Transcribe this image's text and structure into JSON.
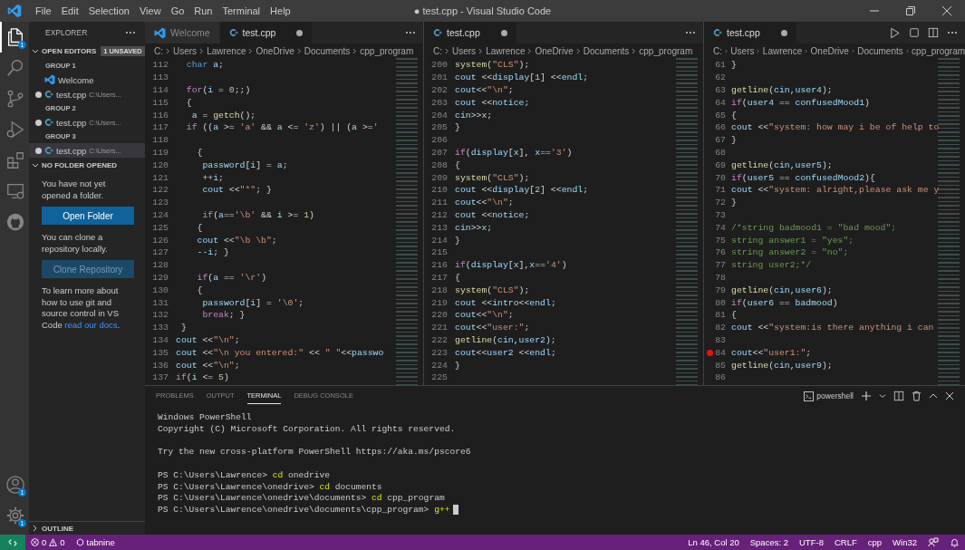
{
  "window": {
    "title": "● test.cpp - Visual Studio Code",
    "menu": [
      "File",
      "Edit",
      "Selection",
      "View",
      "Go",
      "Run",
      "Terminal",
      "Help"
    ]
  },
  "activity_bar": {
    "top": [
      {
        "kind": "explorer",
        "selected": true,
        "badge": "1"
      },
      {
        "kind": "search",
        "selected": false
      },
      {
        "kind": "source-control",
        "selected": false
      },
      {
        "kind": "run-debug",
        "selected": false
      },
      {
        "kind": "extensions",
        "selected": false
      },
      {
        "kind": "remote",
        "selected": false
      },
      {
        "kind": "github",
        "selected": false
      }
    ],
    "bottom": [
      {
        "kind": "account",
        "badge": "1"
      },
      {
        "kind": "settings",
        "badge": "1"
      }
    ]
  },
  "sidebar": {
    "title": "EXPLORER",
    "open_editors": {
      "label": "OPEN EDITORS",
      "badge": "1 UNSAVED",
      "expanded": true,
      "groups": [
        {
          "label": "GROUP 1",
          "items": [
            {
              "kind": "vscode",
              "label": "Welcome",
              "dirty": false,
              "selected": false
            },
            {
              "kind": "cpp",
              "label": "test.cpp",
              "path": "C:\\Users...",
              "dirty": true,
              "selected": false
            }
          ]
        },
        {
          "label": "GROUP 2",
          "items": [
            {
              "kind": "cpp",
              "label": "test.cpp",
              "path": "C:\\Users...",
              "dirty": true,
              "selected": false
            }
          ]
        },
        {
          "label": "GROUP 3",
          "items": [
            {
              "kind": "cpp",
              "label": "test.cpp",
              "path": "C:\\Users...",
              "dirty": true,
              "selected": true
            }
          ]
        }
      ]
    },
    "no_folder": {
      "label": "NO FOLDER OPENED",
      "expanded": true,
      "text1": "You have not yet opened a folder.",
      "open_button": "Open Folder",
      "text2": "You can clone a repository locally.",
      "clone_button": "Clone Repository",
      "text3": "To learn more about how to use git and source control in VS Code",
      "link": "read our docs",
      "text3_end": "."
    },
    "outline": {
      "label": "OUTLINE",
      "expanded": false
    }
  },
  "editors": [
    {
      "tabs": [
        {
          "kind": "vscode",
          "label": "Welcome",
          "selected": false,
          "dirty": false
        },
        {
          "kind": "cpp",
          "label": "test.cpp",
          "selected": true,
          "dirty": true
        }
      ],
      "actions": [
        {
          "kind": "more"
        }
      ],
      "breadcrumbs": [
        "C:",
        "Users",
        "Lawrence",
        "OneDrive",
        "Documents",
        "cpp_program"
      ],
      "lines": [
        {
          "n": "112",
          "parts": [
            {
              "kind": "type",
              "text": "  char"
            },
            {
              "kind": "var",
              "text": " a"
            },
            {
              "kind": "p",
              "text": ";"
            }
          ]
        },
        {
          "n": "113"
        },
        {
          "n": "114",
          "parts": [
            {
              "kind": "kw",
              "text": "  for"
            },
            {
              "kind": "p",
              "text": "("
            },
            {
              "kind": "var",
              "text": "i"
            },
            {
              "kind": "p",
              "text": " = "
            },
            {
              "kind": "num",
              "text": "0"
            },
            {
              "kind": "p",
              "text": ";;)"
            }
          ]
        },
        {
          "n": "115",
          "parts": [
            {
              "kind": "p",
              "text": "  {"
            }
          ]
        },
        {
          "n": "116",
          "parts": [
            {
              "kind": "var",
              "text": "   a"
            },
            {
              "kind": "p",
              "text": " = "
            },
            {
              "kind": "fn",
              "text": "getch"
            },
            {
              "kind": "p",
              "text": "();"
            }
          ]
        },
        {
          "n": "117",
          "parts": [
            {
              "kind": "kw",
              "text": "  if"
            },
            {
              "kind": "p",
              "text": " (("
            },
            {
              "kind": "var",
              "text": "a"
            },
            {
              "kind": "p",
              "text": " >= "
            },
            {
              "kind": "str",
              "text": "'a'"
            },
            {
              "kind": "p",
              "text": " && "
            },
            {
              "kind": "var",
              "text": "a"
            },
            {
              "kind": "p",
              "text": " <= "
            },
            {
              "kind": "str",
              "text": "'z'"
            },
            {
              "kind": "p",
              "text": ") || ("
            },
            {
              "kind": "var",
              "text": "a"
            },
            {
              "kind": "p",
              "text": " >="
            },
            {
              "kind": "str",
              "text": "'"
            }
          ]
        },
        {
          "n": "118"
        },
        {
          "n": "119",
          "parts": [
            {
              "kind": "p",
              "text": "    {"
            }
          ]
        },
        {
          "n": "120",
          "parts": [
            {
              "kind": "var",
              "text": "     password"
            },
            {
              "kind": "p",
              "text": "["
            },
            {
              "kind": "var",
              "text": "i"
            },
            {
              "kind": "p",
              "text": "] = "
            },
            {
              "kind": "var",
              "text": "a"
            },
            {
              "kind": "p",
              "text": ";"
            }
          ]
        },
        {
          "n": "121",
          "parts": [
            {
              "kind": "p",
              "text": "     ++"
            },
            {
              "kind": "var",
              "text": "i"
            },
            {
              "kind": "p",
              "text": ";"
            }
          ]
        },
        {
          "n": "122",
          "parts": [
            {
              "kind": "var",
              "text": "     cout"
            },
            {
              "kind": "p",
              "text": " <<"
            },
            {
              "kind": "str",
              "text": "\"*\""
            },
            {
              "kind": "p",
              "text": "; }"
            }
          ]
        },
        {
          "n": "123"
        },
        {
          "n": "124",
          "parts": [
            {
              "kind": "kw",
              "text": "     if"
            },
            {
              "kind": "p",
              "text": "("
            },
            {
              "kind": "var",
              "text": "a"
            },
            {
              "kind": "p",
              "text": "=="
            },
            {
              "kind": "str",
              "text": "'\\b'"
            },
            {
              "kind": "p",
              "text": " && "
            },
            {
              "kind": "var",
              "text": "i"
            },
            {
              "kind": "p",
              "text": " >= "
            },
            {
              "kind": "num",
              "text": "1"
            },
            {
              "kind": "p",
              "text": ")"
            }
          ]
        },
        {
          "n": "125",
          "parts": [
            {
              "kind": "p",
              "text": "    {"
            }
          ]
        },
        {
          "n": "126",
          "parts": [
            {
              "kind": "var",
              "text": "    cout"
            },
            {
              "kind": "p",
              "text": " <<"
            },
            {
              "kind": "str",
              "text": "\"\\b \\b\""
            },
            {
              "kind": "p",
              "text": ";"
            }
          ]
        },
        {
          "n": "127",
          "parts": [
            {
              "kind": "p",
              "text": "    --"
            },
            {
              "kind": "var",
              "text": "i"
            },
            {
              "kind": "p",
              "text": "; }"
            }
          ]
        },
        {
          "n": "128"
        },
        {
          "n": "129",
          "parts": [
            {
              "kind": "kw",
              "text": "    if"
            },
            {
              "kind": "p",
              "text": "("
            },
            {
              "kind": "var",
              "text": "a"
            },
            {
              "kind": "p",
              "text": " == "
            },
            {
              "kind": "str",
              "text": "'\\r'"
            },
            {
              "kind": "p",
              "text": ")"
            }
          ]
        },
        {
          "n": "130",
          "parts": [
            {
              "kind": "p",
              "text": "    {"
            }
          ]
        },
        {
          "n": "131",
          "parts": [
            {
              "kind": "var",
              "text": "     password"
            },
            {
              "kind": "p",
              "text": "["
            },
            {
              "kind": "var",
              "text": "i"
            },
            {
              "kind": "p",
              "text": "] = "
            },
            {
              "kind": "str",
              "text": "'\\0'"
            },
            {
              "kind": "p",
              "text": ";"
            }
          ]
        },
        {
          "n": "132",
          "parts": [
            {
              "kind": "kw",
              "text": "     break"
            },
            {
              "kind": "p",
              "text": "; }"
            }
          ]
        },
        {
          "n": "133",
          "parts": [
            {
              "kind": "p",
              "text": " }"
            }
          ]
        },
        {
          "n": "134",
          "parts": [
            {
              "kind": "var",
              "text": "cout"
            },
            {
              "kind": "p",
              "text": " <<"
            },
            {
              "kind": "str",
              "text": "\"\\n\""
            },
            {
              "kind": "p",
              "text": ";"
            }
          ]
        },
        {
          "n": "135",
          "parts": [
            {
              "kind": "var",
              "text": "cout"
            },
            {
              "kind": "p",
              "text": " <<"
            },
            {
              "kind": "str",
              "text": "\"\\n you entered:\""
            },
            {
              "kind": "p",
              "text": " << "
            },
            {
              "kind": "str",
              "text": "\" \""
            },
            {
              "kind": "p",
              "text": "<<"
            },
            {
              "kind": "var",
              "text": "passwo"
            }
          ]
        },
        {
          "n": "136",
          "parts": [
            {
              "kind": "var",
              "text": "cout"
            },
            {
              "kind": "p",
              "text": " <<"
            },
            {
              "kind": "str",
              "text": "\"\\n\""
            },
            {
              "kind": "p",
              "text": ";"
            }
          ]
        },
        {
          "n": "137",
          "parts": [
            {
              "kind": "kw",
              "text": "if"
            },
            {
              "kind": "p",
              "text": "("
            },
            {
              "kind": "var",
              "text": "i"
            },
            {
              "kind": "p",
              "text": " <= "
            },
            {
              "kind": "num",
              "text": "5"
            },
            {
              "kind": "p",
              "text": ")"
            }
          ]
        }
      ]
    },
    {
      "tabs": [
        {
          "kind": "cpp",
          "label": "test.cpp",
          "selected": true,
          "dirty": true
        }
      ],
      "actions": [
        {
          "kind": "more"
        }
      ],
      "breadcrumbs": [
        "C:",
        "Users",
        "Lawrence",
        "OneDrive",
        "Documents",
        "cpp_program"
      ],
      "lines": [
        {
          "n": "200",
          "parts": [
            {
              "kind": "fn",
              "text": "system"
            },
            {
              "kind": "p",
              "text": "("
            },
            {
              "kind": "str",
              "text": "\"CLS\""
            },
            {
              "kind": "p",
              "text": ");"
            }
          ]
        },
        {
          "n": "201",
          "parts": [
            {
              "kind": "var",
              "text": "cout"
            },
            {
              "kind": "p",
              "text": " <<"
            },
            {
              "kind": "var",
              "text": "display"
            },
            {
              "kind": "p",
              "text": "["
            },
            {
              "kind": "num",
              "text": "1"
            },
            {
              "kind": "p",
              "text": "] <<"
            },
            {
              "kind": "var",
              "text": "endl"
            },
            {
              "kind": "p",
              "text": ";"
            }
          ]
        },
        {
          "n": "202",
          "parts": [
            {
              "kind": "var",
              "text": "cout"
            },
            {
              "kind": "p",
              "text": "<<"
            },
            {
              "kind": "str",
              "text": "\"\\n\""
            },
            {
              "kind": "p",
              "text": ";"
            }
          ]
        },
        {
          "n": "203",
          "parts": [
            {
              "kind": "var",
              "text": "cout"
            },
            {
              "kind": "p",
              "text": " <<"
            },
            {
              "kind": "var",
              "text": "notice"
            },
            {
              "kind": "p",
              "text": ";"
            }
          ]
        },
        {
          "n": "204",
          "parts": [
            {
              "kind": "var",
              "text": "cin"
            },
            {
              "kind": "p",
              "text": ">>"
            },
            {
              "kind": "var",
              "text": "x"
            },
            {
              "kind": "p",
              "text": ";"
            }
          ]
        },
        {
          "n": "205",
          "parts": [
            {
              "kind": "p",
              "text": "}"
            }
          ]
        },
        {
          "n": "206"
        },
        {
          "n": "207",
          "parts": [
            {
              "kind": "kw",
              "text": "if"
            },
            {
              "kind": "p",
              "text": "("
            },
            {
              "kind": "var",
              "text": "display"
            },
            {
              "kind": "p",
              "text": "["
            },
            {
              "kind": "var",
              "text": "x"
            },
            {
              "kind": "p",
              "text": "], "
            },
            {
              "kind": "var",
              "text": "x"
            },
            {
              "kind": "p",
              "text": "=="
            },
            {
              "kind": "str",
              "text": "'3'"
            },
            {
              "kind": "p",
              "text": ")"
            }
          ]
        },
        {
          "n": "208",
          "parts": [
            {
              "kind": "p",
              "text": "{"
            }
          ]
        },
        {
          "n": "209",
          "parts": [
            {
              "kind": "fn",
              "text": "system"
            },
            {
              "kind": "p",
              "text": "("
            },
            {
              "kind": "str",
              "text": "\"CLS\""
            },
            {
              "kind": "p",
              "text": ");"
            }
          ]
        },
        {
          "n": "210",
          "parts": [
            {
              "kind": "var",
              "text": "cout"
            },
            {
              "kind": "p",
              "text": " <<"
            },
            {
              "kind": "var",
              "text": "display"
            },
            {
              "kind": "p",
              "text": "["
            },
            {
              "kind": "num",
              "text": "2"
            },
            {
              "kind": "p",
              "text": "] <<"
            },
            {
              "kind": "var",
              "text": "endl"
            },
            {
              "kind": "p",
              "text": ";"
            }
          ]
        },
        {
          "n": "211",
          "parts": [
            {
              "kind": "var",
              "text": "cout"
            },
            {
              "kind": "p",
              "text": "<<"
            },
            {
              "kind": "str",
              "text": "\"\\n\""
            },
            {
              "kind": "p",
              "text": ";"
            }
          ]
        },
        {
          "n": "212",
          "parts": [
            {
              "kind": "var",
              "text": "cout"
            },
            {
              "kind": "p",
              "text": " <<"
            },
            {
              "kind": "var",
              "text": "notice"
            },
            {
              "kind": "p",
              "text": ";"
            }
          ]
        },
        {
          "n": "213",
          "parts": [
            {
              "kind": "var",
              "text": "cin"
            },
            {
              "kind": "p",
              "text": ">>"
            },
            {
              "kind": "var",
              "text": "x"
            },
            {
              "kind": "p",
              "text": ";"
            }
          ]
        },
        {
          "n": "214",
          "parts": [
            {
              "kind": "p",
              "text": "}"
            }
          ]
        },
        {
          "n": "215"
        },
        {
          "n": "216",
          "parts": [
            {
              "kind": "kw",
              "text": "if"
            },
            {
              "kind": "p",
              "text": "("
            },
            {
              "kind": "var",
              "text": "display"
            },
            {
              "kind": "p",
              "text": "["
            },
            {
              "kind": "var",
              "text": "x"
            },
            {
              "kind": "p",
              "text": "],"
            },
            {
              "kind": "var",
              "text": "x"
            },
            {
              "kind": "p",
              "text": "=="
            },
            {
              "kind": "str",
              "text": "'4'"
            },
            {
              "kind": "p",
              "text": ")"
            }
          ]
        },
        {
          "n": "217",
          "parts": [
            {
              "kind": "p",
              "text": "{"
            }
          ]
        },
        {
          "n": "218",
          "parts": [
            {
              "kind": "fn",
              "text": "system"
            },
            {
              "kind": "p",
              "text": "("
            },
            {
              "kind": "str",
              "text": "\"CLS\""
            },
            {
              "kind": "p",
              "text": ");"
            }
          ]
        },
        {
          "n": "219",
          "parts": [
            {
              "kind": "var",
              "text": "cout"
            },
            {
              "kind": "p",
              "text": " <<"
            },
            {
              "kind": "var",
              "text": "intro"
            },
            {
              "kind": "p",
              "text": "<<"
            },
            {
              "kind": "var",
              "text": "endl"
            },
            {
              "kind": "p",
              "text": ";"
            }
          ]
        },
        {
          "n": "220",
          "parts": [
            {
              "kind": "var",
              "text": "cout"
            },
            {
              "kind": "p",
              "text": "<<"
            },
            {
              "kind": "str",
              "text": "\"\\n\""
            },
            {
              "kind": "p",
              "text": ";"
            }
          ]
        },
        {
          "n": "221",
          "parts": [
            {
              "kind": "var",
              "text": "cout"
            },
            {
              "kind": "p",
              "text": "<<"
            },
            {
              "kind": "str",
              "text": "\"user:\""
            },
            {
              "kind": "p",
              "text": ";"
            }
          ]
        },
        {
          "n": "222",
          "parts": [
            {
              "kind": "fn",
              "text": "getline"
            },
            {
              "kind": "p",
              "text": "("
            },
            {
              "kind": "var",
              "text": "cin"
            },
            {
              "kind": "p",
              "text": ","
            },
            {
              "kind": "var",
              "text": "user2"
            },
            {
              "kind": "p",
              "text": ");"
            }
          ]
        },
        {
          "n": "223",
          "parts": [
            {
              "kind": "var",
              "text": "cout"
            },
            {
              "kind": "p",
              "text": "<<"
            },
            {
              "kind": "var",
              "text": "user2"
            },
            {
              "kind": "p",
              "text": " <<"
            },
            {
              "kind": "var",
              "text": "endl"
            },
            {
              "kind": "p",
              "text": ";"
            }
          ]
        },
        {
          "n": "224",
          "parts": [
            {
              "kind": "p",
              "text": "}"
            }
          ]
        },
        {
          "n": "225"
        }
      ]
    },
    {
      "tabs": [
        {
          "kind": "cpp",
          "label": "test.cpp",
          "selected": true,
          "dirty": true
        }
      ],
      "actions": [
        {
          "kind": "run"
        },
        {
          "kind": "square"
        },
        {
          "kind": "split"
        },
        {
          "kind": "more"
        }
      ],
      "breadcrumbs": [
        "C:",
        "Users",
        "Lawrence",
        "OneDrive",
        "Documents",
        "cpp_program"
      ],
      "lines": [
        {
          "n": "61",
          "breakpoint": false,
          "parts": [
            {
              "kind": "p",
              "text": "}"
            }
          ]
        },
        {
          "n": "62",
          "breakpoint": false
        },
        {
          "n": "63",
          "breakpoint": false,
          "parts": [
            {
              "kind": "fn",
              "text": "getline"
            },
            {
              "kind": "p",
              "text": "("
            },
            {
              "kind": "var",
              "text": "cin"
            },
            {
              "kind": "p",
              "text": ","
            },
            {
              "kind": "var",
              "text": "user4"
            },
            {
              "kind": "p",
              "text": ");"
            }
          ]
        },
        {
          "n": "64",
          "breakpoint": false,
          "parts": [
            {
              "kind": "kw",
              "text": "if"
            },
            {
              "kind": "p",
              "text": "("
            },
            {
              "kind": "var",
              "text": "user4"
            },
            {
              "kind": "p",
              "text": " == "
            },
            {
              "kind": "var",
              "text": "confusedMood1"
            },
            {
              "kind": "p",
              "text": ")"
            }
          ]
        },
        {
          "n": "65",
          "breakpoint": false,
          "parts": [
            {
              "kind": "p",
              "text": "{"
            }
          ]
        },
        {
          "n": "66",
          "breakpoint": false,
          "parts": [
            {
              "kind": "var",
              "text": "cout"
            },
            {
              "kind": "p",
              "text": " <<"
            },
            {
              "kind": "str",
              "text": "\"system: how may i be of help to"
            }
          ]
        },
        {
          "n": "67",
          "breakpoint": false,
          "parts": [
            {
              "kind": "p",
              "text": "}"
            }
          ]
        },
        {
          "n": "68",
          "breakpoint": false
        },
        {
          "n": "69",
          "breakpoint": false,
          "parts": [
            {
              "kind": "fn",
              "text": "getline"
            },
            {
              "kind": "p",
              "text": "("
            },
            {
              "kind": "var",
              "text": "cin"
            },
            {
              "kind": "p",
              "text": ","
            },
            {
              "kind": "var",
              "text": "user5"
            },
            {
              "kind": "p",
              "text": ");"
            }
          ]
        },
        {
          "n": "70",
          "breakpoint": false,
          "parts": [
            {
              "kind": "kw",
              "text": "if"
            },
            {
              "kind": "p",
              "text": "("
            },
            {
              "kind": "var",
              "text": "user5"
            },
            {
              "kind": "p",
              "text": " == "
            },
            {
              "kind": "var",
              "text": "confusedMood2"
            },
            {
              "kind": "p",
              "text": "){"
            }
          ]
        },
        {
          "n": "71",
          "breakpoint": false,
          "parts": [
            {
              "kind": "var",
              "text": "cout"
            },
            {
              "kind": "p",
              "text": " <<"
            },
            {
              "kind": "str",
              "text": "\"system: alright,please ask me y"
            }
          ]
        },
        {
          "n": "72",
          "breakpoint": false,
          "parts": [
            {
              "kind": "p",
              "text": "}"
            }
          ]
        },
        {
          "n": "73",
          "breakpoint": false
        },
        {
          "n": "74",
          "breakpoint": false,
          "parts": [
            {
              "kind": "cmt",
              "text": "/*string badmood1 = \"bad mood\";"
            }
          ]
        },
        {
          "n": "75",
          "breakpoint": false,
          "parts": [
            {
              "kind": "cmt",
              "text": "string answer1 = \"yes\";"
            }
          ]
        },
        {
          "n": "76",
          "breakpoint": false,
          "parts": [
            {
              "kind": "cmt",
              "text": "string answer2 = \"no\";"
            }
          ]
        },
        {
          "n": "77",
          "breakpoint": false,
          "parts": [
            {
              "kind": "cmt",
              "text": "string user2;*/"
            }
          ]
        },
        {
          "n": "78",
          "breakpoint": false
        },
        {
          "n": "79",
          "breakpoint": false,
          "parts": [
            {
              "kind": "fn",
              "text": "getline"
            },
            {
              "kind": "p",
              "text": "("
            },
            {
              "kind": "var",
              "text": "cin"
            },
            {
              "kind": "p",
              "text": ","
            },
            {
              "kind": "var",
              "text": "user6"
            },
            {
              "kind": "p",
              "text": ");"
            }
          ]
        },
        {
          "n": "80",
          "breakpoint": false,
          "parts": [
            {
              "kind": "kw",
              "text": "if"
            },
            {
              "kind": "p",
              "text": "("
            },
            {
              "kind": "var",
              "text": "user6"
            },
            {
              "kind": "p",
              "text": " == "
            },
            {
              "kind": "var",
              "text": "badmood"
            },
            {
              "kind": "p",
              "text": ")"
            }
          ]
        },
        {
          "n": "81",
          "breakpoint": false,
          "parts": [
            {
              "kind": "p",
              "text": "{"
            }
          ]
        },
        {
          "n": "82",
          "breakpoint": false,
          "parts": [
            {
              "kind": "var",
              "text": "cout"
            },
            {
              "kind": "p",
              "text": " <<"
            },
            {
              "kind": "str",
              "text": "\"system:is there anything i can"
            }
          ]
        },
        {
          "n": "83",
          "breakpoint": false
        },
        {
          "n": "84",
          "breakpoint": true,
          "parts": [
            {
              "kind": "var",
              "text": "cout"
            },
            {
              "kind": "p",
              "text": "<<"
            },
            {
              "kind": "str",
              "text": "\"user1:\""
            },
            {
              "kind": "p",
              "text": ";"
            }
          ]
        },
        {
          "n": "85",
          "breakpoint": false,
          "parts": [
            {
              "kind": "fn",
              "text": "getline"
            },
            {
              "kind": "p",
              "text": "("
            },
            {
              "kind": "var",
              "text": "cin"
            },
            {
              "kind": "p",
              "text": ","
            },
            {
              "kind": "var",
              "text": "user9"
            },
            {
              "kind": "p",
              "text": ");"
            }
          ]
        },
        {
          "n": "86",
          "breakpoint": false
        }
      ]
    }
  ],
  "panel": {
    "tabs": [
      {
        "label": "PROBLEMS",
        "selected": false
      },
      {
        "label": "OUTPUT",
        "selected": false
      },
      {
        "label": "TERMINAL",
        "selected": true
      },
      {
        "label": "DEBUG CONSOLE",
        "selected": false
      }
    ],
    "terminal_name": "powershell",
    "lines": [
      {
        "kind": "output",
        "text": "Windows PowerShell"
      },
      {
        "kind": "output",
        "text": "Copyright (C) Microsoft Corporation. All rights reserved."
      },
      {
        "kind": "blank"
      },
      {
        "kind": "output",
        "text": "Try the new cross-platform PowerShell https://aka.ms/pscore6"
      },
      {
        "kind": "blank"
      },
      {
        "kind": "command",
        "prompt": "PS C:\\Users\\Lawrence>",
        "cmd": "cd",
        "arg": "onedrive",
        "cursor": false
      },
      {
        "kind": "command",
        "prompt": "PS C:\\Users\\Lawrence\\onedrive>",
        "cmd": "cd",
        "arg": "documents",
        "cursor": false
      },
      {
        "kind": "command",
        "prompt": "PS C:\\Users\\Lawrence\\onedrive\\documents>",
        "cmd": "cd",
        "arg": "cpp_program",
        "cursor": false
      },
      {
        "kind": "command",
        "prompt": "PS C:\\Users\\Lawrence\\onedrive\\documents\\cpp_program>",
        "cmd": "g++",
        "cursor": true
      }
    ]
  },
  "status_bar": {
    "errors": "0",
    "warnings": "0",
    "tabnine": "tabnine",
    "right": [
      "Ln 46, Col 20",
      "Spaces: 2",
      "UTF-8",
      "CRLF",
      "cpp",
      "Win32"
    ]
  }
}
